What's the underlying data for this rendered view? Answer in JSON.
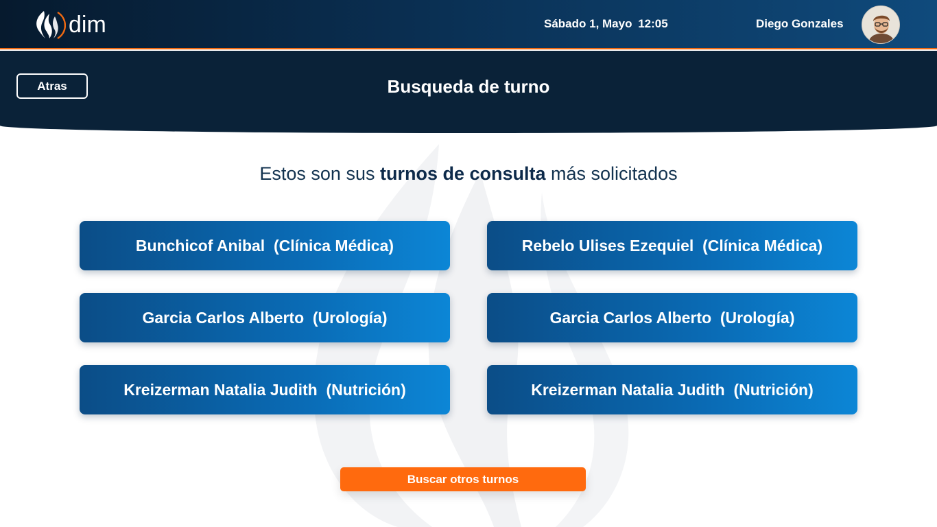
{
  "app": {
    "logo_text": "dim"
  },
  "topbar": {
    "date": "Sábado 1, Mayo",
    "time": "12:05",
    "user_name": "Diego Gonzales"
  },
  "header": {
    "back_label": "Atras",
    "title": "Busqueda de turno"
  },
  "intro": {
    "prefix": "Estos son sus",
    "highlight": "turnos de consulta",
    "suffix": "más solicitados"
  },
  "appointments": [
    {
      "label": "Bunchicof Anibal  (Clínica Médica)"
    },
    {
      "label": "Rebelo Ulises Ezequiel  (Clínica Médica)"
    },
    {
      "label": "Garcia Carlos Alberto  (Urología)"
    },
    {
      "label": "Garcia Carlos Alberto  (Urología)"
    },
    {
      "label": "Kreizerman Natalia Judith  (Nutrición)"
    },
    {
      "label": "Kreizerman Natalia Judith  (Nutrición)"
    }
  ],
  "actions": {
    "search_other_label": "Buscar otros turnos"
  },
  "colors": {
    "accent": "#ff6a0e",
    "primary_dark": "#0a2238",
    "card_blue": "#0a6bb5"
  },
  "icons": {
    "logo": "flame-logo-icon",
    "avatar": "user-avatar-icon",
    "watermark": "flame-watermark-icon"
  }
}
